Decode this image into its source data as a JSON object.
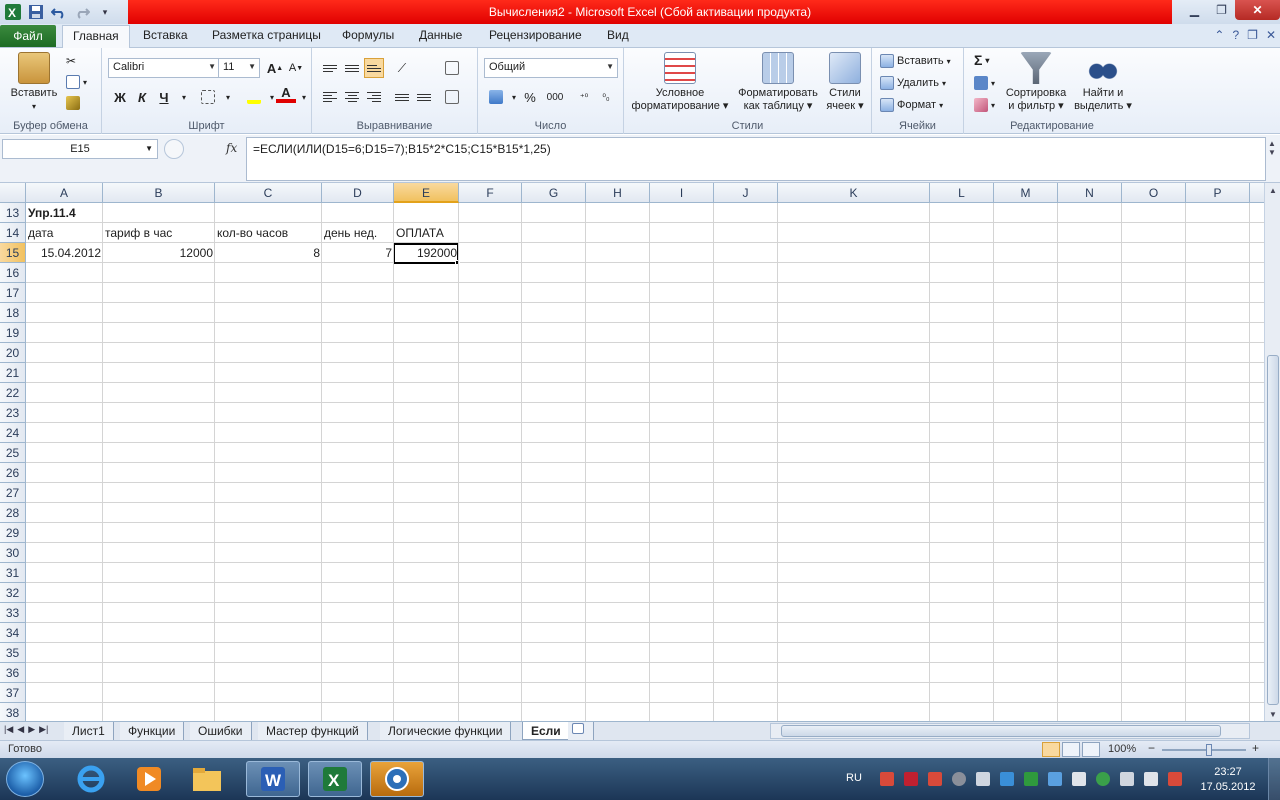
{
  "window": {
    "title": "Вычисления2 - Microsoft Excel (Сбой активации продукта)"
  },
  "ribbon_tabs": {
    "file": "Файл",
    "home": "Главная",
    "insert": "Вставка",
    "page_layout": "Разметка страницы",
    "formulas": "Формулы",
    "data": "Данные",
    "review": "Рецензирование",
    "view": "Вид"
  },
  "ribbon": {
    "clipboard": {
      "label": "Буфер обмена",
      "paste": "Вставить"
    },
    "font": {
      "label": "Шрифт",
      "font_name": "Calibri",
      "font_size": "11",
      "bold": "Ж",
      "italic": "К",
      "underline": "Ч",
      "grow": "A",
      "shrink": "A"
    },
    "alignment": {
      "label": "Выравнивание"
    },
    "number": {
      "label": "Число",
      "format": "Общий",
      "percent": "%",
      "thousands": "000"
    },
    "styles": {
      "label": "Стили",
      "conditional": "Условное\nформатирование",
      "conditional_1": "Условное",
      "conditional_2": "форматирование",
      "table_1": "Форматировать",
      "table_2": "как таблицу",
      "cell_1": "Стили",
      "cell_2": "ячеек"
    },
    "cells": {
      "label": "Ячейки",
      "insert": "Вставить",
      "delete": "Удалить",
      "format": "Формат"
    },
    "editing": {
      "label": "Редактирование",
      "sum": "Σ",
      "sort_1": "Сортировка",
      "sort_2": "и фильтр",
      "find_1": "Найти и",
      "find_2": "выделить"
    }
  },
  "formula_bar": {
    "name_box": "E15",
    "fx": "fx",
    "formula": "=ЕСЛИ(ИЛИ(D15=6;D15=7);B15*2*C15;C15*B15*1,25)"
  },
  "sheet": {
    "columns": [
      "A",
      "B",
      "C",
      "D",
      "E",
      "F",
      "G",
      "H",
      "I",
      "J",
      "K",
      "L",
      "M",
      "N",
      "O",
      "P"
    ],
    "rows": [
      "13",
      "14",
      "15",
      "16",
      "17",
      "18",
      "19",
      "20",
      "21",
      "22",
      "23",
      "24",
      "25",
      "26",
      "27",
      "28",
      "29",
      "30",
      "31",
      "32",
      "33",
      "34",
      "35",
      "36",
      "37",
      "38"
    ],
    "selected_cell": "E15",
    "cells": {
      "A13": "Упр.11.4",
      "A14": "дата",
      "B14": "тариф в час",
      "C14": "кол-во часов",
      "D14": "день нед.",
      "E14": "ОПЛАТА",
      "A15": "15.04.2012",
      "B15": "12000",
      "C15": "8",
      "D15": "7",
      "E15": "192000"
    }
  },
  "sheet_tabs": [
    "Лист1",
    "Функции",
    "Ошибки",
    "Мастер функций",
    "Логические функции",
    "Если"
  ],
  "active_sheet": "Если",
  "status_bar": {
    "ready": "Готово",
    "zoom": "100%",
    "zoom_minus": "−",
    "zoom_plus": "+"
  },
  "taskbar": {
    "language": "RU",
    "time": "23:27",
    "date": "17.05.2012"
  },
  "colors": {
    "title_red": "#e00000",
    "file_tab_green": "#1d6b24",
    "selected_header": "#f1c15f"
  }
}
